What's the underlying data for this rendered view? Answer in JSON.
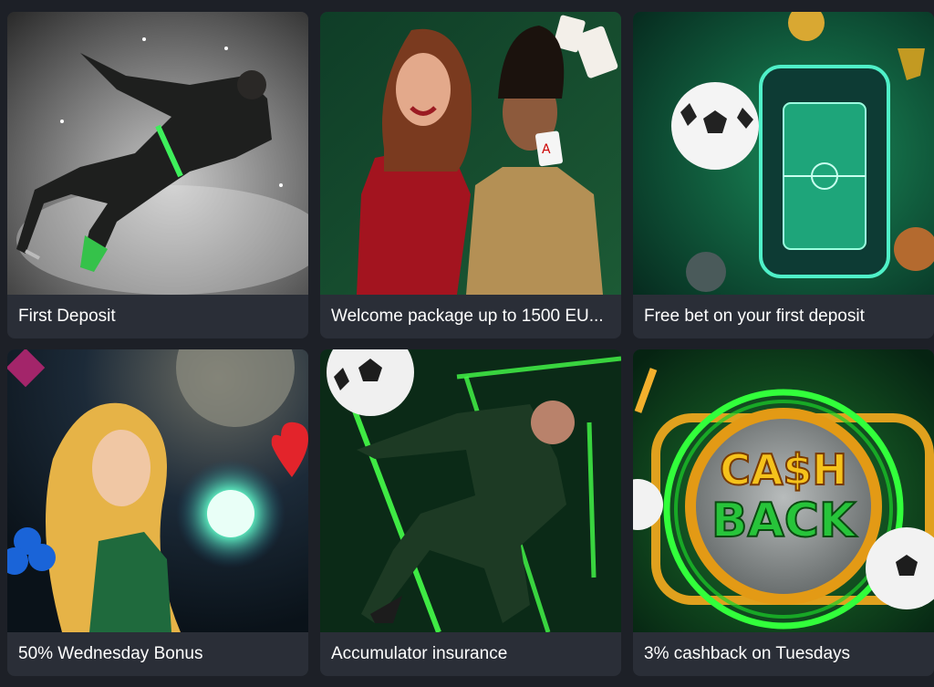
{
  "promotions": [
    {
      "title": "First Deposit",
      "image": "footballer-kick-grey-smoke"
    },
    {
      "title": "Welcome package up to 1500 EU...",
      "image": "casino-women-holding-cards"
    },
    {
      "title": "Free bet on your first deposit",
      "image": "football-phone-trophy-neon"
    },
    {
      "title": "50% Wednesday Bonus",
      "image": "fantasy-blonde-magic-orb-card-suits"
    },
    {
      "title": "Accumulator insurance",
      "image": "footballer-neon-green-lines"
    },
    {
      "title": "3% cashback on Tuesdays",
      "image": "cashback-coin-neon-rings"
    }
  ],
  "cashback_art_text": [
    "CA$H",
    "BACK"
  ],
  "colors": {
    "page_bg": "#1d2027",
    "card_bg": "#2a2e37",
    "accent_green": "#1fd14a",
    "text": "#ffffff"
  }
}
